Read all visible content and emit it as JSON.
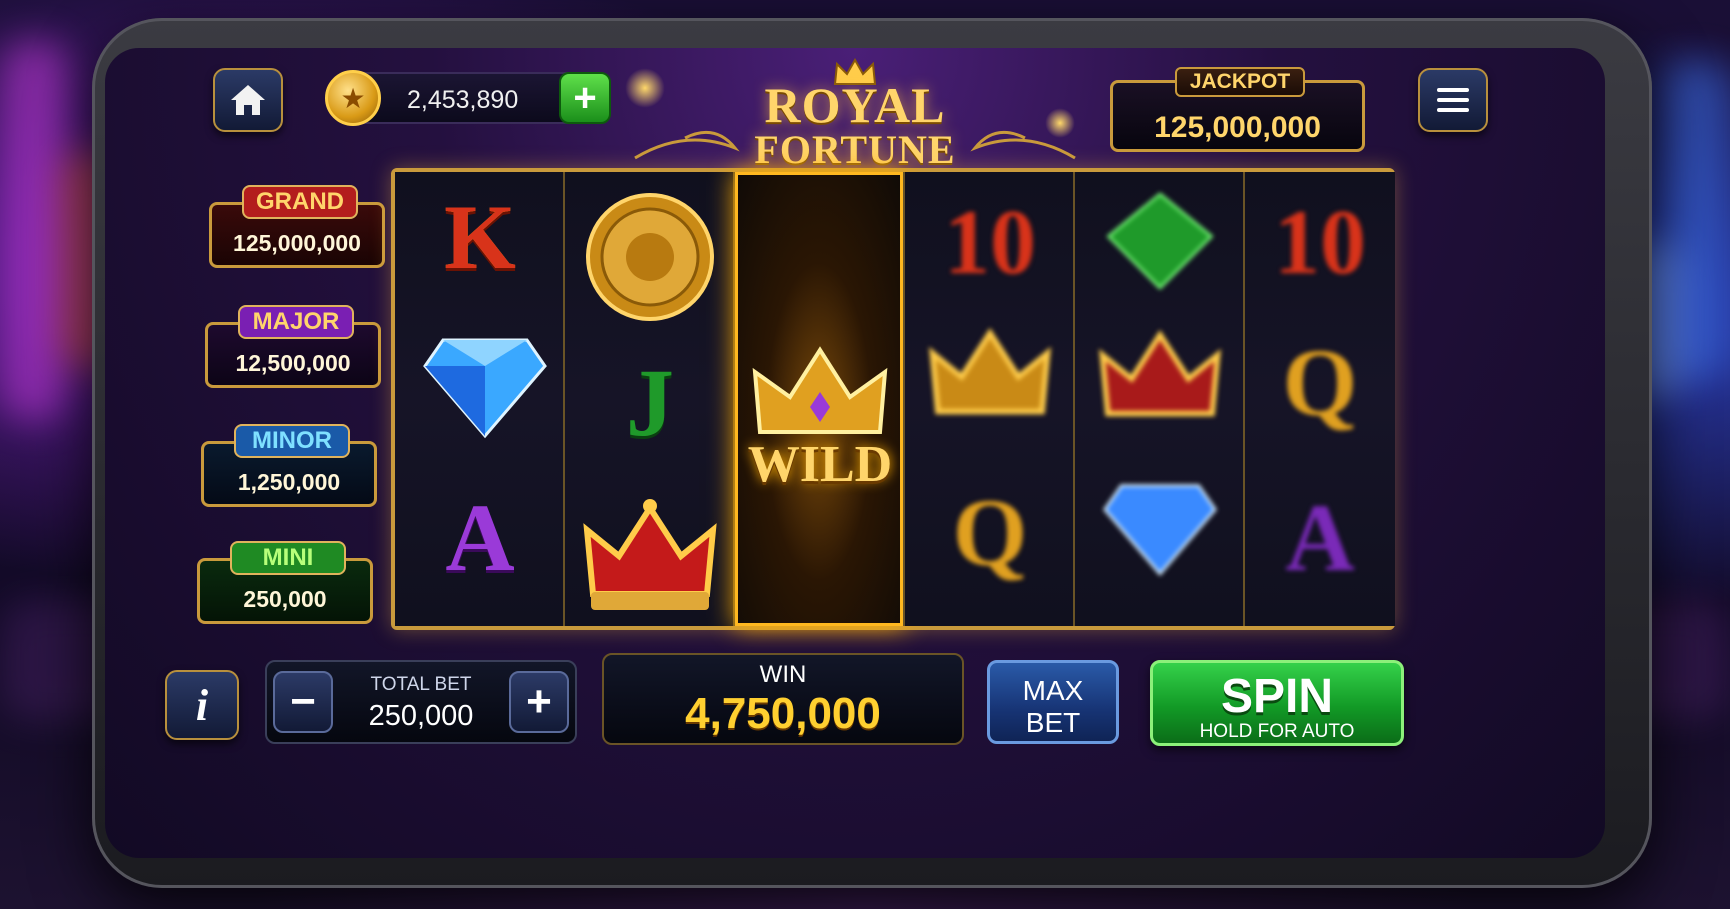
{
  "top_bar": {
    "home_icon": "home-icon",
    "coin_balance": "2,453,890",
    "add_coins_label": "+",
    "menu_icon": "hamburger-menu-icon"
  },
  "title": {
    "line1": "ROYAL",
    "line2": "FORTUNE"
  },
  "jackpot": {
    "label": "JACKPOT",
    "value": "125,000,000"
  },
  "tiers": [
    {
      "label": "GRAND",
      "value": "125,000,000",
      "color": "#b31d1d"
    },
    {
      "label": "MAJOR",
      "value": "12,500,000",
      "color": "#7a1fb3"
    },
    {
      "label": "MINOR",
      "value": "1,250,000",
      "color": "#1a5aa8"
    },
    {
      "label": "MINI",
      "value": "250,000",
      "color": "#1f8a23"
    }
  ],
  "reels": [
    [
      "K",
      "diamond",
      "A"
    ],
    [
      "lion-coin",
      "J",
      "crown"
    ],
    [
      "wild"
    ],
    [
      "10",
      "crown",
      "Q"
    ],
    [
      "emerald",
      "crown",
      "diamond"
    ],
    [
      "10",
      "Q",
      "A"
    ]
  ],
  "wild_label": "WILD",
  "bottom": {
    "info_label": "i",
    "minus_label": "−",
    "plus_label": "+",
    "total_bet_label": "TOTAL BET",
    "total_bet_value": "250,000",
    "win_label": "WIN",
    "win_value": "4,750,000",
    "max_bet_line1": "MAX",
    "max_bet_line2": "BET",
    "spin_label": "SPIN",
    "spin_sub": "HOLD FOR AUTO"
  },
  "colors": {
    "gold": "#ffd56b",
    "spin_green": "#129a26",
    "wild_glow": "#ffae00"
  }
}
